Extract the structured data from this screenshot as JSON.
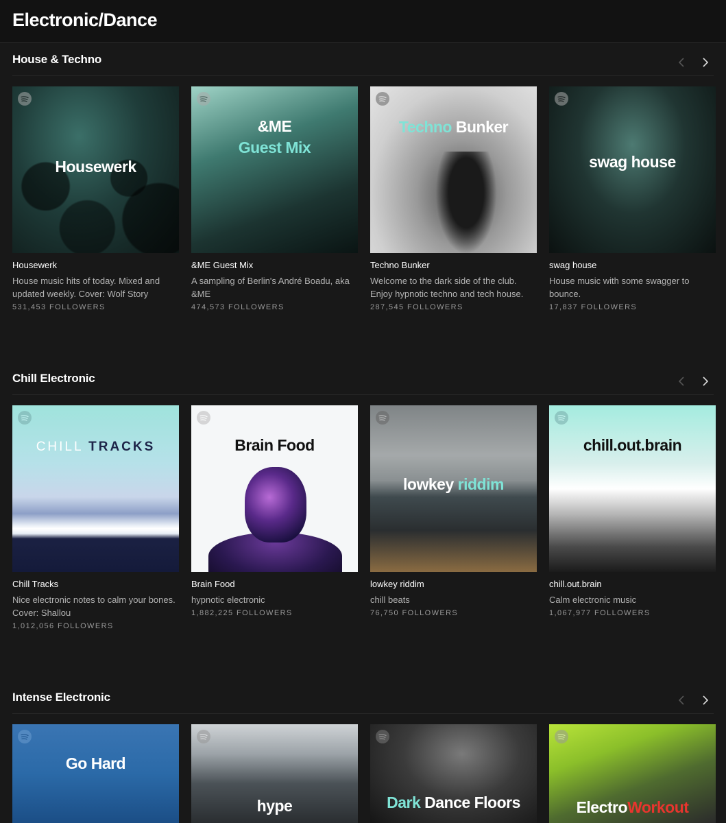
{
  "page": {
    "title": "Electronic/Dance"
  },
  "sections": [
    {
      "title": "House & Techno",
      "cards": [
        {
          "cover_text": "Housewerk",
          "title": "Housewerk",
          "description": "House music hits of today. Mixed and updated weekly. Cover: Wolf Story",
          "followers": "531,453 FOLLOWERS"
        },
        {
          "cover_text_1": "&ME",
          "cover_text_2": "Guest Mix",
          "title": "&ME Guest Mix",
          "description": "A sampling of Berlin's André Boadu, aka &ME",
          "followers": "474,573 FOLLOWERS"
        },
        {
          "cover_text_1": "Techno",
          "cover_text_2": "Bunker",
          "title": "Techno Bunker",
          "description": "Welcome to the dark side of the club. Enjoy hypnotic techno and tech house.",
          "followers": "287,545 FOLLOWERS"
        },
        {
          "cover_text": "swag house",
          "title": "swag house",
          "description": "House music with some swagger to bounce.",
          "followers": "17,837 FOLLOWERS"
        }
      ]
    },
    {
      "title": "Chill Electronic",
      "cards": [
        {
          "cover_text_1": "CHILL",
          "cover_text_2": "TRACKS",
          "title": "Chill Tracks",
          "description": "Nice electronic notes to calm your bones. Cover: Shallou",
          "followers": "1,012,056 FOLLOWERS"
        },
        {
          "cover_text": "Brain Food",
          "title": "Brain Food",
          "description": "hypnotic electronic",
          "followers": "1,882,225 FOLLOWERS"
        },
        {
          "cover_text_1": "lowkey",
          "cover_text_2": "riddim",
          "title": "lowkey riddim",
          "description": "chill beats",
          "followers": "76,750 FOLLOWERS"
        },
        {
          "cover_text": "chill.out.brain",
          "title": "chill.out.brain",
          "description": "Calm electronic music",
          "followers": "1,067,977 FOLLOWERS"
        }
      ]
    },
    {
      "title": "Intense Electronic",
      "cards": [
        {
          "cover_text": "Go Hard"
        },
        {
          "cover_text": "hype"
        },
        {
          "cover_text_1": "Dark",
          "cover_text_2": "Dance Floors"
        },
        {
          "cover_text_1": "Electro",
          "cover_text_2": "Workout"
        }
      ]
    }
  ],
  "colors": {
    "accent_teal": "#7fe3d6",
    "accent_red": "#e8352e",
    "background": "#181818"
  },
  "icons": {
    "logo": "spotify-logo-icon",
    "prev": "chevron-left-icon",
    "next": "chevron-right-icon"
  }
}
